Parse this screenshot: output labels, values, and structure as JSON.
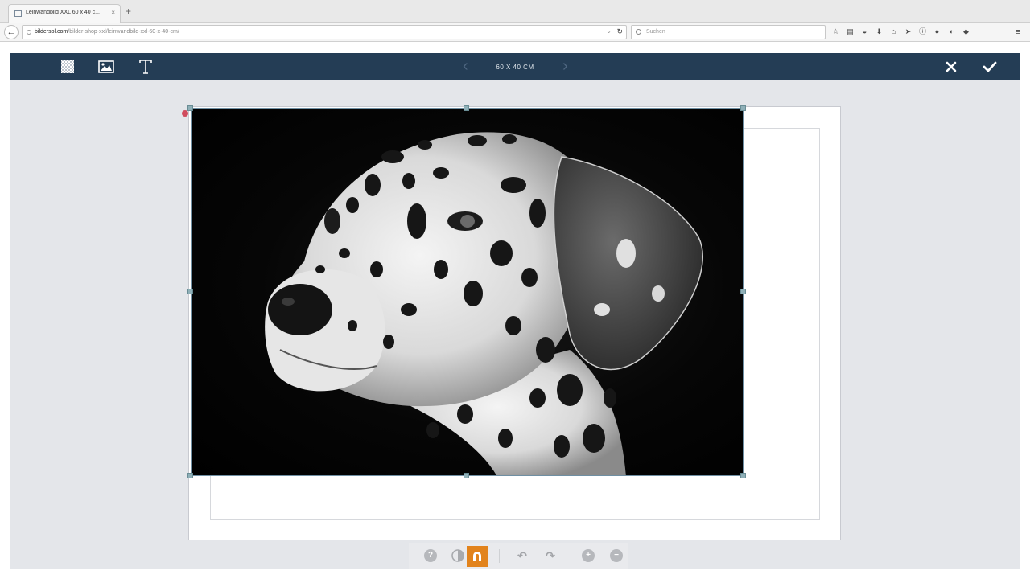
{
  "browser": {
    "tab_title": "Leinwandbild XXL 60 x 40 c...",
    "tab_close": "×",
    "new_tab": "+",
    "url_domain": "bildersol.com",
    "url_path": "/bilder-shop-xxl/leinwandbild-xxl-60-x-40-cm/",
    "search_placeholder": "Suchen",
    "menu": "≡"
  },
  "editor": {
    "size_label": "60 X 40 CM",
    "prev_arrow": "‹",
    "next_arrow": "›",
    "toolbar_tools": [
      "background-pattern-icon",
      "image-icon",
      "text-icon"
    ],
    "accent_color": "#e2831c",
    "toolbar_color": "#243d55"
  },
  "image": {
    "subject": "Black and white portrait of a Dalmatian dog on a black background"
  },
  "bottom_tools": {
    "help": "?",
    "undo": "↶",
    "redo": "↷",
    "zoom_in": "+",
    "zoom_out": "−"
  }
}
